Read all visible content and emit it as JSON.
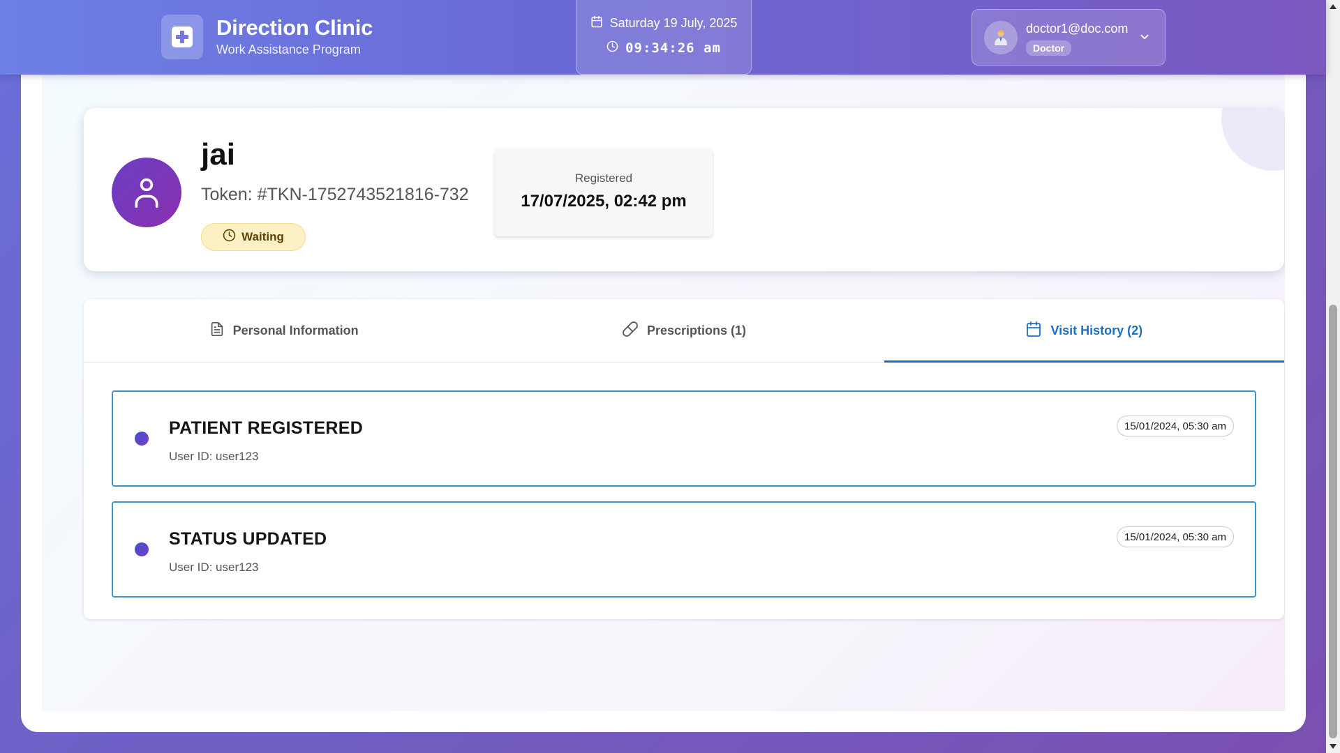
{
  "header": {
    "brand_title": "Direction Clinic",
    "brand_subtitle": "Work Assistance Program",
    "date": "Saturday 19 July, 2025",
    "time": "09:34:26 am",
    "user_email": "doctor1@doc.com",
    "user_role": "Doctor",
    "icons": {
      "logo": "medical-plus-icon",
      "date": "calendar-icon",
      "time": "clock-icon",
      "avatar": "doctor-avatar-icon",
      "dropdown": "chevron-down-icon"
    }
  },
  "patient": {
    "name": "jai",
    "token": "Token: #TKN-1752743521816-732",
    "status": "Waiting",
    "registered_label": "Registered",
    "registered_value": "17/07/2025, 02:42 pm",
    "icons": {
      "avatar": "user-icon",
      "status": "clock-icon"
    }
  },
  "tabs": [
    {
      "label": "Personal Information",
      "icon": "document-icon",
      "active": false
    },
    {
      "label": "Prescriptions (1)",
      "icon": "pill-icon",
      "active": false
    },
    {
      "label": "Visit History (2)",
      "icon": "calendar-icon",
      "active": true
    }
  ],
  "history": [
    {
      "title": "PATIENT REGISTERED",
      "user": "User ID: user123",
      "timestamp": "15/01/2024, 05:30 am"
    },
    {
      "title": "STATUS UPDATED",
      "user": "User ID: user123",
      "timestamp": "15/01/2024, 05:30 am"
    }
  ],
  "colors": {
    "accent": "#1e6fc2",
    "status_waiting_bg": "#fdf0c4",
    "history_border": "#3d93cf",
    "avatar_gradient_start": "#6b3fc2",
    "avatar_gradient_end": "#8a2fb0"
  }
}
